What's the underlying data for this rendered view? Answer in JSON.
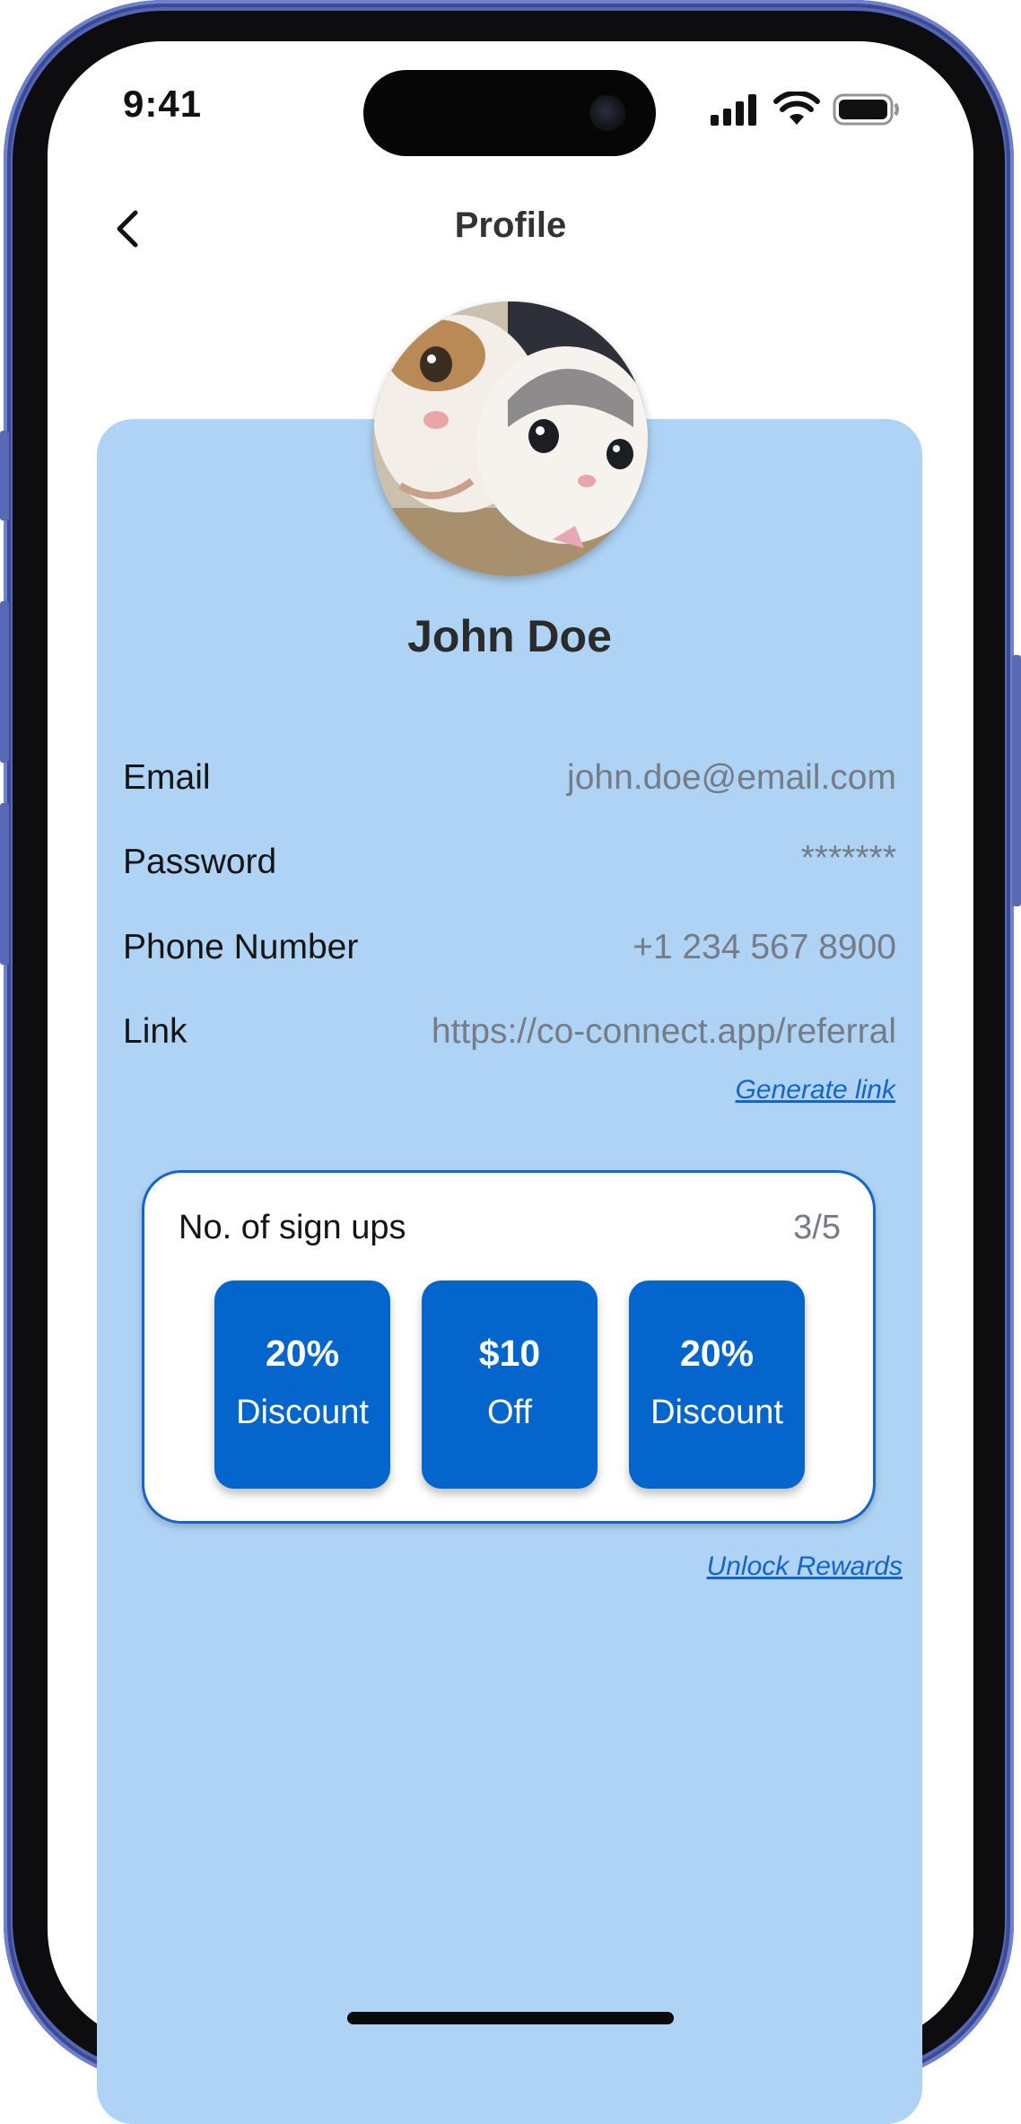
{
  "status_bar": {
    "time": "9:41",
    "icons": [
      "signal-icon",
      "wifi-icon",
      "battery-icon"
    ]
  },
  "header": {
    "back_icon": "chevron-left-icon",
    "title": "Profile"
  },
  "profile": {
    "avatar": "avatar-photo",
    "name": "John Doe",
    "fields": [
      {
        "label": "Email",
        "value": "john.doe@email.com"
      },
      {
        "label": "Password",
        "value": "*******"
      },
      {
        "label": "Phone Number",
        "value": "+1 234 567 8900"
      },
      {
        "label": "Link",
        "value": "https://co-connect.app/referral"
      }
    ],
    "generate_link": "Generate link"
  },
  "rewards": {
    "label": "No. of sign ups",
    "count": "3/5",
    "tiles": [
      {
        "amount": "20%",
        "desc": "Discount"
      },
      {
        "amount": "$10",
        "desc": "Off"
      },
      {
        "amount": "20%",
        "desc": "Discount"
      }
    ],
    "unlock": "Unlock Rewards"
  },
  "colors": {
    "card_bg": "#aed3f4",
    "accent": "#0466cc",
    "link": "#1565c9",
    "frame": "#5566b5"
  }
}
